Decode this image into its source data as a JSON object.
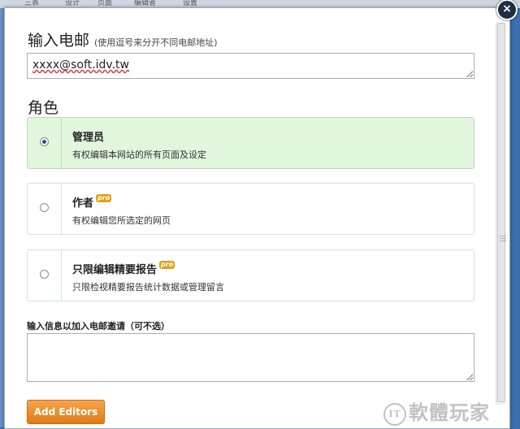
{
  "background_tabs": [
    "三表",
    "设计",
    "页面",
    "编辑者",
    "设置"
  ],
  "dialog": {
    "email_heading": "输入电邮",
    "email_hint": "(使用逗号来分开不同电邮地址)",
    "email_value": "xxxx@soft.idv.tw",
    "role_heading": "角色",
    "roles": [
      {
        "title": "管理员",
        "description": "有权编辑本网站的所有页面及设定",
        "selected": true,
        "pro": false
      },
      {
        "title": "作者",
        "description": "有权编辑您所选定的网页",
        "selected": false,
        "pro": true
      },
      {
        "title": "只限编辑精要报告",
        "description": "只限检视精要报告统计数据或管理留言",
        "selected": false,
        "pro": true
      }
    ],
    "pro_badge": "pro",
    "invite_label": "输入信息以加入电邮邀请（可不选）",
    "invite_value": "",
    "add_button": "Add Editors",
    "close_symbol": "×"
  },
  "watermark": {
    "logo": "IT",
    "text": "軟體玩家"
  },
  "colors": {
    "selected_card": "#e2f6de",
    "button": "#e88a22",
    "frame": "#3a6fb0"
  }
}
